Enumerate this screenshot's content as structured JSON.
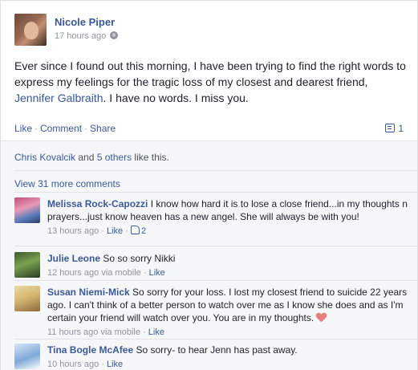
{
  "post": {
    "author": "Nicole Piper",
    "time": "17 hours ago",
    "privacy_icon": "globe-icon",
    "text_before_link": "Ever since I found out this morning, I have been trying to find the right words to express my feelings for the tragic loss of my closest and dearest friend, ",
    "tagged_friend": "Jennifer Galbraith",
    "text_after_link": ". I have no words. I miss you."
  },
  "actions": {
    "like": "Like",
    "comment": "Comment",
    "share": "Share",
    "separator": "·",
    "comment_count": "1"
  },
  "likes": {
    "first_name": "Chris Kovalcik",
    "middle": " and ",
    "others": "5 others",
    "suffix": " like this."
  },
  "view_more": "View 31 more comments",
  "comments": [
    {
      "name": "Melissa Rock-Capozzi",
      "text": "I know how hard it is to lose a close friend...in my thoughts n prayers...just know heaven has a new angel. She will always be with you!",
      "time": "13 hours ago",
      "via": "",
      "like": "Like",
      "like_count": "2"
    },
    {
      "name": "Julie Leone",
      "text": "So so sorry Nikki",
      "time": "12 hours ago",
      "via": " via mobile",
      "like": "Like"
    },
    {
      "name": "Susan Niemi-Mick",
      "text": "So sorry for your loss. I lost my closest friend to suicide 22 years ago. I can't think of a better person to watch over me as I know she does and as I'm certain your friend will watch over you. You are in my thoughts.",
      "time": "11 hours ago",
      "via": " via mobile",
      "like": "Like"
    },
    {
      "name": "Tina Bogle McAfee",
      "text": "So sorry- to hear Jenn has past away.",
      "time": "10 hours ago",
      "via": "",
      "like": "Like"
    }
  ],
  "colors": {
    "link": "#3b5998",
    "meta": "#90949c",
    "ufi_background": "#f6f7f9",
    "heart": "#e87e7e"
  }
}
